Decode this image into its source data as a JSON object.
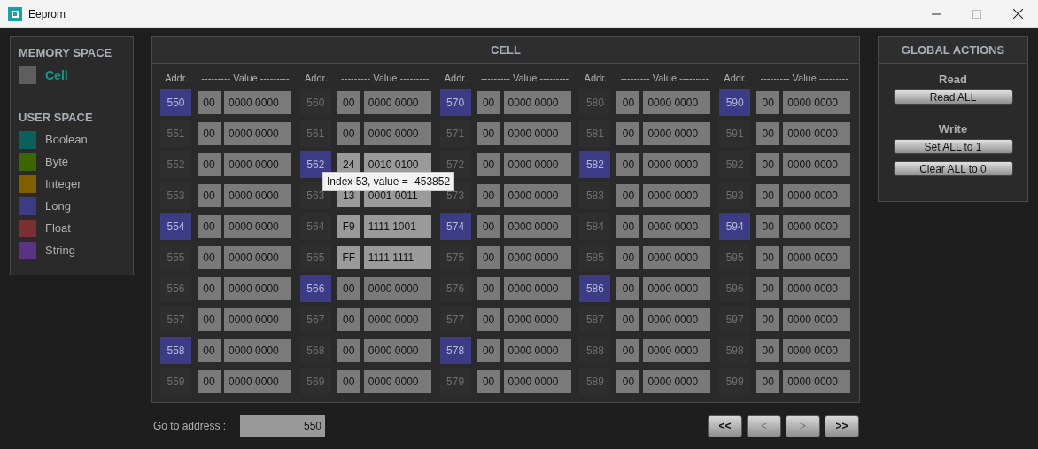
{
  "window": {
    "title": "Eeprom"
  },
  "memory_space": {
    "title": "MEMORY SPACE",
    "items": [
      {
        "label": "Cell",
        "color": "#5e5e5e"
      }
    ]
  },
  "user_space": {
    "title": "USER SPACE",
    "items": [
      {
        "label": "Boolean",
        "color": "#0b5f5f"
      },
      {
        "label": "Byte",
        "color": "#3d6600"
      },
      {
        "label": "Integer",
        "color": "#7f6000"
      },
      {
        "label": "Long",
        "color": "#3c3c86"
      },
      {
        "label": "Float",
        "color": "#7a3030"
      },
      {
        "label": "String",
        "color": "#5c3285"
      }
    ]
  },
  "cell_panel": {
    "title": "CELL",
    "columns": [
      {
        "addr_header": "Addr.",
        "value_header": "--------- Value ---------",
        "cells": [
          {
            "addr": "550",
            "hex": "00",
            "bin": "0000 0000",
            "color": "#3c3c86",
            "highlighted": false
          },
          {
            "addr": "551",
            "hex": "00",
            "bin": "0000 0000",
            "color": "#2e2e2e",
            "highlighted": false
          },
          {
            "addr": "552",
            "hex": "00",
            "bin": "0000 0000",
            "color": "#2e2e2e",
            "highlighted": false
          },
          {
            "addr": "553",
            "hex": "00",
            "bin": "0000 0000",
            "color": "#2e2e2e",
            "highlighted": false
          },
          {
            "addr": "554",
            "hex": "00",
            "bin": "0000 0000",
            "color": "#3c3c86",
            "highlighted": false
          },
          {
            "addr": "555",
            "hex": "00",
            "bin": "0000 0000",
            "color": "#2e2e2e",
            "highlighted": false
          },
          {
            "addr": "556",
            "hex": "00",
            "bin": "0000 0000",
            "color": "#2e2e2e",
            "highlighted": false
          },
          {
            "addr": "557",
            "hex": "00",
            "bin": "0000 0000",
            "color": "#2e2e2e",
            "highlighted": false
          },
          {
            "addr": "558",
            "hex": "00",
            "bin": "0000 0000",
            "color": "#3c3c86",
            "highlighted": false
          },
          {
            "addr": "559",
            "hex": "00",
            "bin": "0000 0000",
            "color": "#2e2e2e",
            "highlighted": false
          }
        ]
      },
      {
        "addr_header": "Addr.",
        "value_header": "--------- Value ---------",
        "cells": [
          {
            "addr": "560",
            "hex": "00",
            "bin": "0000 0000",
            "color": "#2e2e2e",
            "highlighted": false
          },
          {
            "addr": "561",
            "hex": "00",
            "bin": "0000 0000",
            "color": "#2e2e2e",
            "highlighted": false
          },
          {
            "addr": "562",
            "hex": "24",
            "bin": "0010 0100",
            "color": "#3c3c86",
            "highlighted": true
          },
          {
            "addr": "563",
            "hex": "13",
            "bin": "0001 0011",
            "color": "#2e2e2e",
            "highlighted": true
          },
          {
            "addr": "564",
            "hex": "F9",
            "bin": "1111 1001",
            "color": "#2e2e2e",
            "highlighted": true
          },
          {
            "addr": "565",
            "hex": "FF",
            "bin": "1111 1111",
            "color": "#2e2e2e",
            "highlighted": true
          },
          {
            "addr": "566",
            "hex": "00",
            "bin": "0000 0000",
            "color": "#3c3c86",
            "highlighted": false
          },
          {
            "addr": "567",
            "hex": "00",
            "bin": "0000 0000",
            "color": "#2e2e2e",
            "highlighted": false
          },
          {
            "addr": "568",
            "hex": "00",
            "bin": "0000 0000",
            "color": "#2e2e2e",
            "highlighted": false
          },
          {
            "addr": "569",
            "hex": "00",
            "bin": "0000 0000",
            "color": "#2e2e2e",
            "highlighted": false
          }
        ]
      },
      {
        "addr_header": "Addr.",
        "value_header": "--------- Value ---------",
        "cells": [
          {
            "addr": "570",
            "hex": "00",
            "bin": "0000 0000",
            "color": "#3c3c86",
            "highlighted": false
          },
          {
            "addr": "571",
            "hex": "00",
            "bin": "0000 0000",
            "color": "#2e2e2e",
            "highlighted": false
          },
          {
            "addr": "572",
            "hex": "00",
            "bin": "0000 0000",
            "color": "#2e2e2e",
            "highlighted": false
          },
          {
            "addr": "573",
            "hex": "00",
            "bin": "0000 0000",
            "color": "#2e2e2e",
            "highlighted": false
          },
          {
            "addr": "574",
            "hex": "00",
            "bin": "0000 0000",
            "color": "#3c3c86",
            "highlighted": false
          },
          {
            "addr": "575",
            "hex": "00",
            "bin": "0000 0000",
            "color": "#2e2e2e",
            "highlighted": false
          },
          {
            "addr": "576",
            "hex": "00",
            "bin": "0000 0000",
            "color": "#2e2e2e",
            "highlighted": false
          },
          {
            "addr": "577",
            "hex": "00",
            "bin": "0000 0000",
            "color": "#2e2e2e",
            "highlighted": false
          },
          {
            "addr": "578",
            "hex": "00",
            "bin": "0000 0000",
            "color": "#3c3c86",
            "highlighted": false
          },
          {
            "addr": "579",
            "hex": "00",
            "bin": "0000 0000",
            "color": "#2e2e2e",
            "highlighted": false
          }
        ]
      },
      {
        "addr_header": "Addr.",
        "value_header": "--------- Value ---------",
        "cells": [
          {
            "addr": "580",
            "hex": "00",
            "bin": "0000 0000",
            "color": "#2e2e2e",
            "highlighted": false
          },
          {
            "addr": "581",
            "hex": "00",
            "bin": "0000 0000",
            "color": "#2e2e2e",
            "highlighted": false
          },
          {
            "addr": "582",
            "hex": "00",
            "bin": "0000 0000",
            "color": "#3c3c86",
            "highlighted": false
          },
          {
            "addr": "583",
            "hex": "00",
            "bin": "0000 0000",
            "color": "#2e2e2e",
            "highlighted": false
          },
          {
            "addr": "584",
            "hex": "00",
            "bin": "0000 0000",
            "color": "#2e2e2e",
            "highlighted": false
          },
          {
            "addr": "585",
            "hex": "00",
            "bin": "0000 0000",
            "color": "#2e2e2e",
            "highlighted": false
          },
          {
            "addr": "586",
            "hex": "00",
            "bin": "0000 0000",
            "color": "#3c3c86",
            "highlighted": false
          },
          {
            "addr": "587",
            "hex": "00",
            "bin": "0000 0000",
            "color": "#2e2e2e",
            "highlighted": false
          },
          {
            "addr": "588",
            "hex": "00",
            "bin": "0000 0000",
            "color": "#2e2e2e",
            "highlighted": false
          },
          {
            "addr": "589",
            "hex": "00",
            "bin": "0000 0000",
            "color": "#2e2e2e",
            "highlighted": false
          }
        ]
      },
      {
        "addr_header": "Addr.",
        "value_header": "--------- Value ---------",
        "cells": [
          {
            "addr": "590",
            "hex": "00",
            "bin": "0000 0000",
            "color": "#3c3c86",
            "highlighted": false
          },
          {
            "addr": "591",
            "hex": "00",
            "bin": "0000 0000",
            "color": "#2e2e2e",
            "highlighted": false
          },
          {
            "addr": "592",
            "hex": "00",
            "bin": "0000 0000",
            "color": "#2e2e2e",
            "highlighted": false
          },
          {
            "addr": "593",
            "hex": "00",
            "bin": "0000 0000",
            "color": "#2e2e2e",
            "highlighted": false
          },
          {
            "addr": "594",
            "hex": "00",
            "bin": "0000 0000",
            "color": "#3c3c86",
            "highlighted": false
          },
          {
            "addr": "595",
            "hex": "00",
            "bin": "0000 0000",
            "color": "#2e2e2e",
            "highlighted": false
          },
          {
            "addr": "596",
            "hex": "00",
            "bin": "0000 0000",
            "color": "#2e2e2e",
            "highlighted": false
          },
          {
            "addr": "597",
            "hex": "00",
            "bin": "0000 0000",
            "color": "#2e2e2e",
            "highlighted": false
          },
          {
            "addr": "598",
            "hex": "00",
            "bin": "0000 0000",
            "color": "#2e2e2e",
            "highlighted": false
          },
          {
            "addr": "599",
            "hex": "00",
            "bin": "0000 0000",
            "color": "#2e2e2e",
            "highlighted": false
          }
        ]
      }
    ]
  },
  "tooltip": {
    "text": "Index 53, value = -453852"
  },
  "goto": {
    "label": "Go to address :",
    "value": "550"
  },
  "nav_buttons": [
    {
      "label": "<<",
      "disabled": false
    },
    {
      "label": "<",
      "disabled": true
    },
    {
      "label": ">",
      "disabled": true
    },
    {
      "label": ">>",
      "disabled": false
    }
  ],
  "global_actions": {
    "title": "GLOBAL ACTIONS",
    "groups": [
      {
        "title": "Read",
        "buttons": [
          "Read ALL"
        ]
      },
      {
        "title": "Write",
        "buttons": [
          "Set ALL to 1",
          "Clear ALL to 0"
        ]
      }
    ]
  }
}
